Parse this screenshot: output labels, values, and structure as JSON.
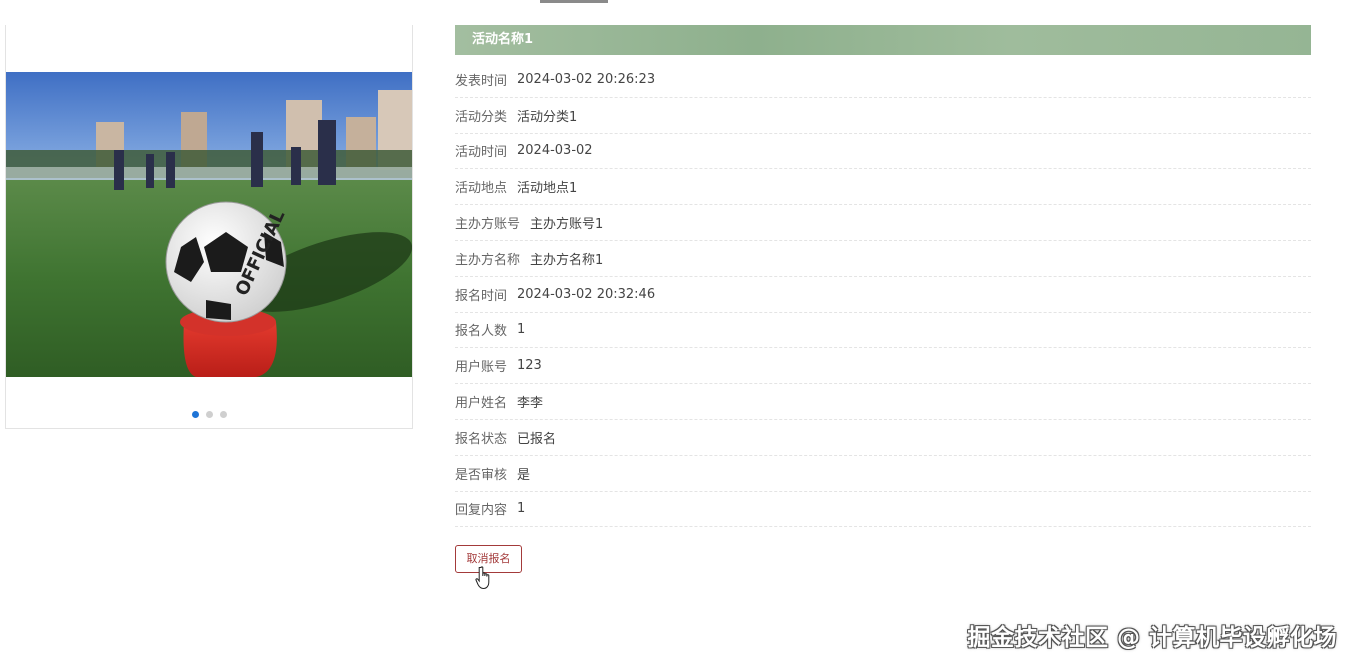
{
  "colors": {
    "title_bar": "#9bb898",
    "accent_button": "#a33a3a",
    "active_dot": "#1e74d6",
    "inactive_dot": "#cfcfcf"
  },
  "carousel": {
    "image": "football-on-field-photo",
    "dots": [
      {
        "active": true
      },
      {
        "active": false
      },
      {
        "active": false
      }
    ]
  },
  "detail": {
    "title": "活动名称1",
    "rows": [
      {
        "label": "发表时间",
        "value": "2024-03-02 20:26:23"
      },
      {
        "label": "活动分类",
        "value": "活动分类1"
      },
      {
        "label": "活动时间",
        "value": "2024-03-02"
      },
      {
        "label": "活动地点",
        "value": "活动地点1"
      },
      {
        "label": "主办方账号",
        "value": "主办方账号1"
      },
      {
        "label": "主办方名称",
        "value": "主办方名称1"
      },
      {
        "label": "报名时间",
        "value": "2024-03-02 20:32:46"
      },
      {
        "label": "报名人数",
        "value": "1"
      },
      {
        "label": "用户账号",
        "value": "123"
      },
      {
        "label": "用户姓名",
        "value": "李李"
      },
      {
        "label": "报名状态",
        "value": "已报名"
      },
      {
        "label": "是否审核",
        "value": "是"
      },
      {
        "label": "回复内容",
        "value": "1"
      }
    ],
    "cancel_label": "取消报名"
  },
  "watermark": "掘金技术社区 @ 计算机毕设孵化场"
}
